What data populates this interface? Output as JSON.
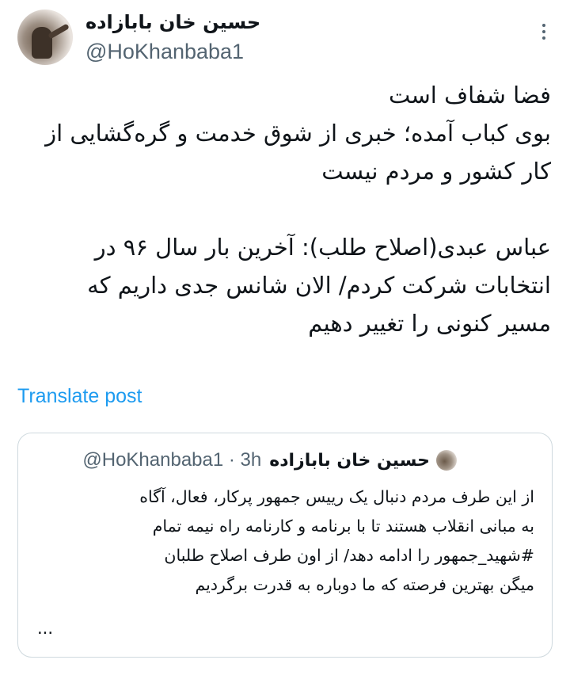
{
  "author": {
    "display_name": "حسین خان بابازاده",
    "handle": "@HoKhanbaba1",
    "avatar_icon": "profile-photo"
  },
  "more_icon": "more-vertical-icon",
  "tweet": {
    "lines": [
      "فضا شفاف است",
      "بوی کباب آمده؛ خبری از شوق خدمت و گره‌گشایی از",
      "کار کشور و مردم نیست",
      "",
      "عباس عبدی(اصلاح طلب): آخرین بار سال ۹۶ در",
      "انتخابات شرکت کردم/ الان شانس جدی داریم که",
      "مسیر کنونی را تغییر دهیم"
    ]
  },
  "translate_label": "Translate post",
  "quoted_post": {
    "display_name": "حسین خان بابازاده",
    "meta": "@HoKhanbaba1 · 3h",
    "lines": [
      "از این طرف مردم دنبال یک رییس جمهور پرکار، فعال، آگاه",
      "به مبانی انقلاب هستند تا با برنامه و کارنامه راه نیمه تمام",
      "#شهید_جمهور را ادامه دهد/ از اون طرف اصلاح طلبان",
      "میگن بهترین فرصته که ما دوباره به قدرت برگردیم"
    ],
    "ellipsis": "..."
  },
  "colors": {
    "text": "#0f1419",
    "secondary": "#536471",
    "link": "#1d9bf0",
    "border": "#cfd9de"
  }
}
